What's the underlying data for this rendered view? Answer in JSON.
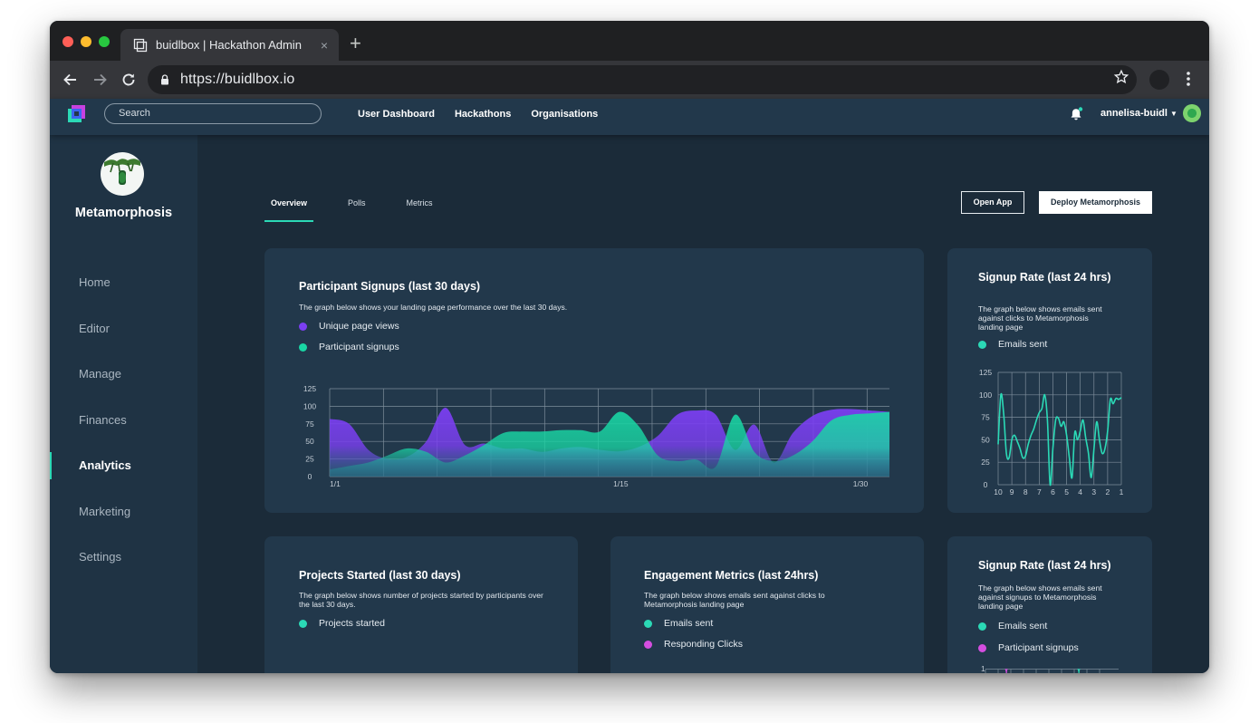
{
  "browser": {
    "tab_title": "buidlbox | Hackathon Admin",
    "tab_close": "×",
    "new_tab": "+",
    "url": "https://buidlbox.io"
  },
  "appbar": {
    "search_placeholder": "Search",
    "nav": [
      "User Dashboard",
      "Hackathons",
      "Organisations"
    ],
    "username": "annelisa-buidl"
  },
  "sidebar": {
    "project_name": "Metamorphosis",
    "items": [
      {
        "label": "Home",
        "active": false
      },
      {
        "label": "Editor",
        "active": false
      },
      {
        "label": "Manage",
        "active": false
      },
      {
        "label": "Finances",
        "active": false
      },
      {
        "label": "Analytics",
        "active": true
      },
      {
        "label": "Marketing",
        "active": false
      },
      {
        "label": "Settings",
        "active": false
      }
    ]
  },
  "main": {
    "tabs": [
      "Overview",
      "Polls",
      "Metrics"
    ],
    "active_tab": "Overview",
    "open_app_label": "Open App",
    "deploy_label": "Deploy Metamorphosis"
  },
  "colors": {
    "accent": "#2bd9b6",
    "purple": "#7b3ff2",
    "green": "#19d6a4",
    "magenta": "#d44ee0"
  },
  "cards": {
    "signups": {
      "title": "Participant Signups (last 30 days)",
      "desc": "The graph below shows your landing page performance over the last 30 days.",
      "legend": [
        "Unique page views",
        "Participant signups"
      ]
    },
    "rate1": {
      "title": "Signup Rate (last 24 hrs)",
      "desc": "The graph below shows emails sent against clicks to Metamorphosis landing page",
      "legend": [
        "Emails sent"
      ]
    },
    "projects": {
      "title": "Projects Started (last 30 days)",
      "desc": "The graph below shows number of projects started by participants over the last 30 days.",
      "legend": [
        "Projects started"
      ]
    },
    "engagement": {
      "title": "Engagement Metrics (last 24hrs)",
      "desc": "The graph below shows emails sent against clicks to Metamorphosis landing page",
      "legend": [
        "Emails sent",
        "Responding Clicks"
      ]
    },
    "rate2": {
      "title": "Signup Rate (last 24 hrs)",
      "desc": "The graph below shows emails sent against signups to Metamorphosis landing page",
      "legend": [
        "Emails sent",
        "Participant signups"
      ],
      "visible_y_tick": "1"
    }
  },
  "chart_data": [
    {
      "type": "area",
      "title": "Participant Signups (last 30 days)",
      "x_tick_labels": [
        "1/1",
        "1/15",
        "1/30"
      ],
      "y_ticks": [
        0,
        25,
        50,
        75,
        100,
        125
      ],
      "ylim": [
        0,
        125
      ],
      "x": [
        1,
        2,
        3,
        4,
        5,
        6,
        7,
        8,
        9,
        10,
        11,
        12,
        13,
        14,
        15,
        16,
        17,
        18,
        19,
        20,
        21,
        22,
        23,
        24,
        25,
        26,
        27,
        28,
        29,
        30
      ],
      "series": [
        {
          "name": "Unique page views",
          "color": "#7b3ff2",
          "values": [
            82,
            75,
            38,
            25,
            28,
            50,
            98,
            45,
            47,
            40,
            40,
            35,
            40,
            42,
            38,
            36,
            42,
            58,
            88,
            94,
            88,
            38,
            74,
            20,
            62,
            86,
            95,
            96,
            94,
            92
          ]
        },
        {
          "name": "Participant signups",
          "color": "#19d6a4",
          "values": [
            10,
            15,
            20,
            30,
            40,
            35,
            20,
            30,
            45,
            62,
            64,
            64,
            66,
            66,
            64,
            92,
            72,
            30,
            22,
            24,
            14,
            88,
            35,
            22,
            30,
            50,
            80,
            88,
            90,
            92
          ]
        }
      ],
      "grid": true
    },
    {
      "type": "line",
      "title": "Signup Rate (last 24 hrs)",
      "x_tick_labels": [
        "10",
        "9",
        "8",
        "7",
        "6",
        "5",
        "4",
        "3",
        "2",
        "1"
      ],
      "y_ticks": [
        0,
        25,
        50,
        75,
        100,
        125
      ],
      "ylim": [
        0,
        125
      ],
      "series": [
        {
          "name": "Emails sent",
          "color": "#2bd9b6",
          "x": [
            10,
            9.8,
            9.6,
            9.4,
            9.2,
            9,
            8.8,
            8.6,
            8.4,
            8.2,
            8,
            7.8,
            7.6,
            7.4,
            7.2,
            7,
            6.8,
            6.6,
            6.4,
            6.2,
            6,
            5.8,
            5.6,
            5.4,
            5.2,
            5,
            4.8,
            4.6,
            4.4,
            4.2,
            4,
            3.8,
            3.6,
            3.4,
            3.2,
            3,
            2.8,
            2.6,
            2.4,
            2.2,
            2,
            1.8,
            1.6,
            1.4,
            1.2,
            1
          ],
          "values": [
            45,
            100,
            80,
            35,
            30,
            50,
            55,
            48,
            40,
            30,
            32,
            45,
            55,
            62,
            72,
            80,
            85,
            100,
            72,
            0,
            40,
            72,
            74,
            65,
            70,
            55,
            30,
            8,
            58,
            50,
            60,
            72,
            52,
            35,
            8,
            40,
            70,
            50,
            35,
            40,
            60,
            95,
            90,
            96,
            95,
            97
          ]
        }
      ],
      "grid": true
    }
  ]
}
